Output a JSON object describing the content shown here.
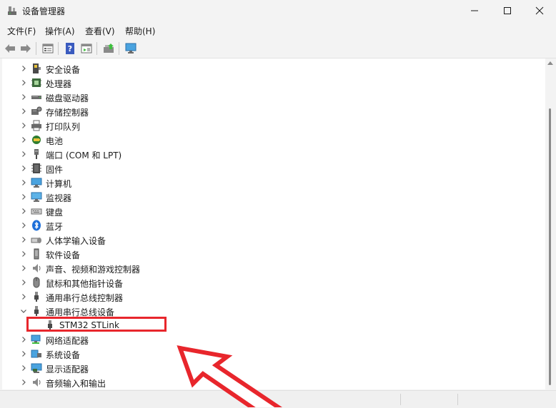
{
  "window": {
    "title": "设备管理器",
    "icon": "device-manager-icon",
    "controls": [
      "minimize-icon",
      "maximize-icon",
      "close-icon"
    ]
  },
  "menu": [
    {
      "label": "文件(F)"
    },
    {
      "label": "操作(A)"
    },
    {
      "label": "查看(V)"
    },
    {
      "label": "帮助(H)"
    }
  ],
  "toolbar": {
    "buttons": [
      "back-arrow-icon",
      "forward-arrow-icon",
      "properties-icon",
      "help-icon",
      "show-hide-icon",
      "update-driver-icon",
      "monitor-scan-icon"
    ]
  },
  "tree": {
    "items": [
      {
        "label": "安全设备",
        "icon": "security-device-icon",
        "expanded": false
      },
      {
        "label": "处理器",
        "icon": "processor-icon",
        "expanded": false
      },
      {
        "label": "磁盘驱动器",
        "icon": "disk-drive-icon",
        "expanded": false
      },
      {
        "label": "存储控制器",
        "icon": "storage-controller-icon",
        "expanded": false
      },
      {
        "label": "打印队列",
        "icon": "printer-icon",
        "expanded": false
      },
      {
        "label": "电池",
        "icon": "battery-icon",
        "expanded": false
      },
      {
        "label": "端口 (COM 和 LPT)",
        "icon": "port-icon",
        "expanded": false
      },
      {
        "label": "固件",
        "icon": "firmware-icon",
        "expanded": false
      },
      {
        "label": "计算机",
        "icon": "computer-icon",
        "expanded": false
      },
      {
        "label": "监视器",
        "icon": "monitor-icon",
        "expanded": false
      },
      {
        "label": "键盘",
        "icon": "keyboard-icon",
        "expanded": false
      },
      {
        "label": "蓝牙",
        "icon": "bluetooth-icon",
        "expanded": false
      },
      {
        "label": "人体学输入设备",
        "icon": "hid-icon",
        "expanded": false
      },
      {
        "label": "软件设备",
        "icon": "software-device-icon",
        "expanded": false
      },
      {
        "label": "声音、视频和游戏控制器",
        "icon": "sound-icon",
        "expanded": false
      },
      {
        "label": "鼠标和其他指针设备",
        "icon": "mouse-icon",
        "expanded": false
      },
      {
        "label": "通用串行总线控制器",
        "icon": "usb-icon",
        "expanded": false
      },
      {
        "label": "通用串行总线设备",
        "icon": "usb-icon",
        "expanded": true
      },
      {
        "label": "STM32 STLink",
        "icon": "usb-icon",
        "child": true
      },
      {
        "label": "网络适配器",
        "icon": "network-adapter-icon",
        "expanded": false
      },
      {
        "label": "系统设备",
        "icon": "system-device-icon",
        "expanded": false
      },
      {
        "label": "显示适配器",
        "icon": "display-adapter-icon",
        "expanded": false
      },
      {
        "label": "音频输入和输出",
        "icon": "audio-io-icon",
        "expanded": false
      }
    ]
  },
  "colors": {
    "highlight": "#e8262c",
    "accent": "#0078d4"
  }
}
